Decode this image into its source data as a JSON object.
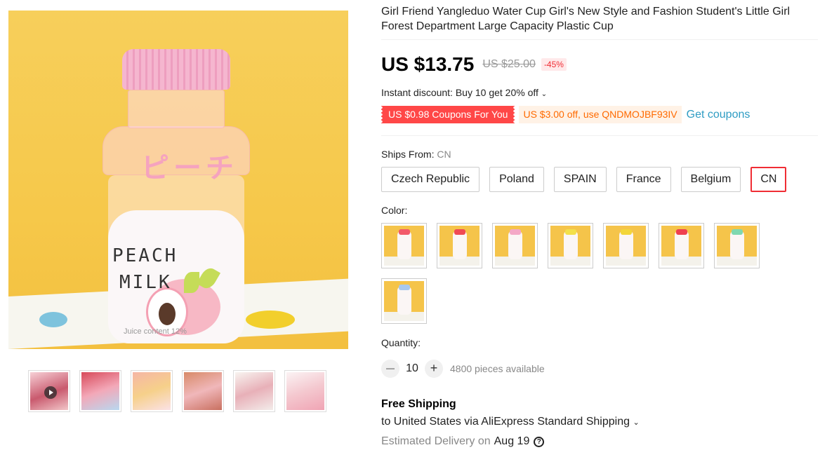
{
  "product": {
    "title": "Girl Friend Yangleduo Water Cup Girl's New Style and Fashion Student's Little Girl Forest Department Large Capacity Plastic Cup",
    "image_text": {
      "jp": "ピーチ",
      "peach": "PEACH",
      "milk": "MILK",
      "juice": "Juice content 12%"
    }
  },
  "thumbnails": [
    {
      "name": "video"
    },
    {
      "name": "group-1"
    },
    {
      "name": "group-2"
    },
    {
      "name": "group-3"
    },
    {
      "name": "group-4"
    },
    {
      "name": "group-5"
    }
  ],
  "price": {
    "current": "US $13.75",
    "original": "US $25.00",
    "discount": "-45%"
  },
  "instant_discount": "Instant discount: Buy 10 get 20% off",
  "coupons": {
    "red": "US $0.98 Coupons For You",
    "code": "US $3.00 off, use QNDMOJBF93IV",
    "get": "Get coupons"
  },
  "ships_from": {
    "label": "Ships From: ",
    "selected": "CN",
    "options": [
      "Czech Republic",
      "Poland",
      "SPAIN",
      "France",
      "Belgium",
      "CN"
    ]
  },
  "color": {
    "label": "Color:",
    "swatch_cap_colors": [
      "#f25a6a",
      "#f04a55",
      "#f4a8c6",
      "#f3e04a",
      "#f3d63a",
      "#ef4050",
      "#7fd8b0",
      "#a8c8ee"
    ]
  },
  "quantity": {
    "label": "Quantity:",
    "value": "10",
    "minus": "—",
    "plus": "+",
    "available": "4800 pieces available"
  },
  "shipping": {
    "free": "Free Shipping",
    "to": "to United States via AliExpress Standard Shipping",
    "est_label": "Estimated Delivery on",
    "est_date": "Aug 19",
    "help": "?"
  }
}
